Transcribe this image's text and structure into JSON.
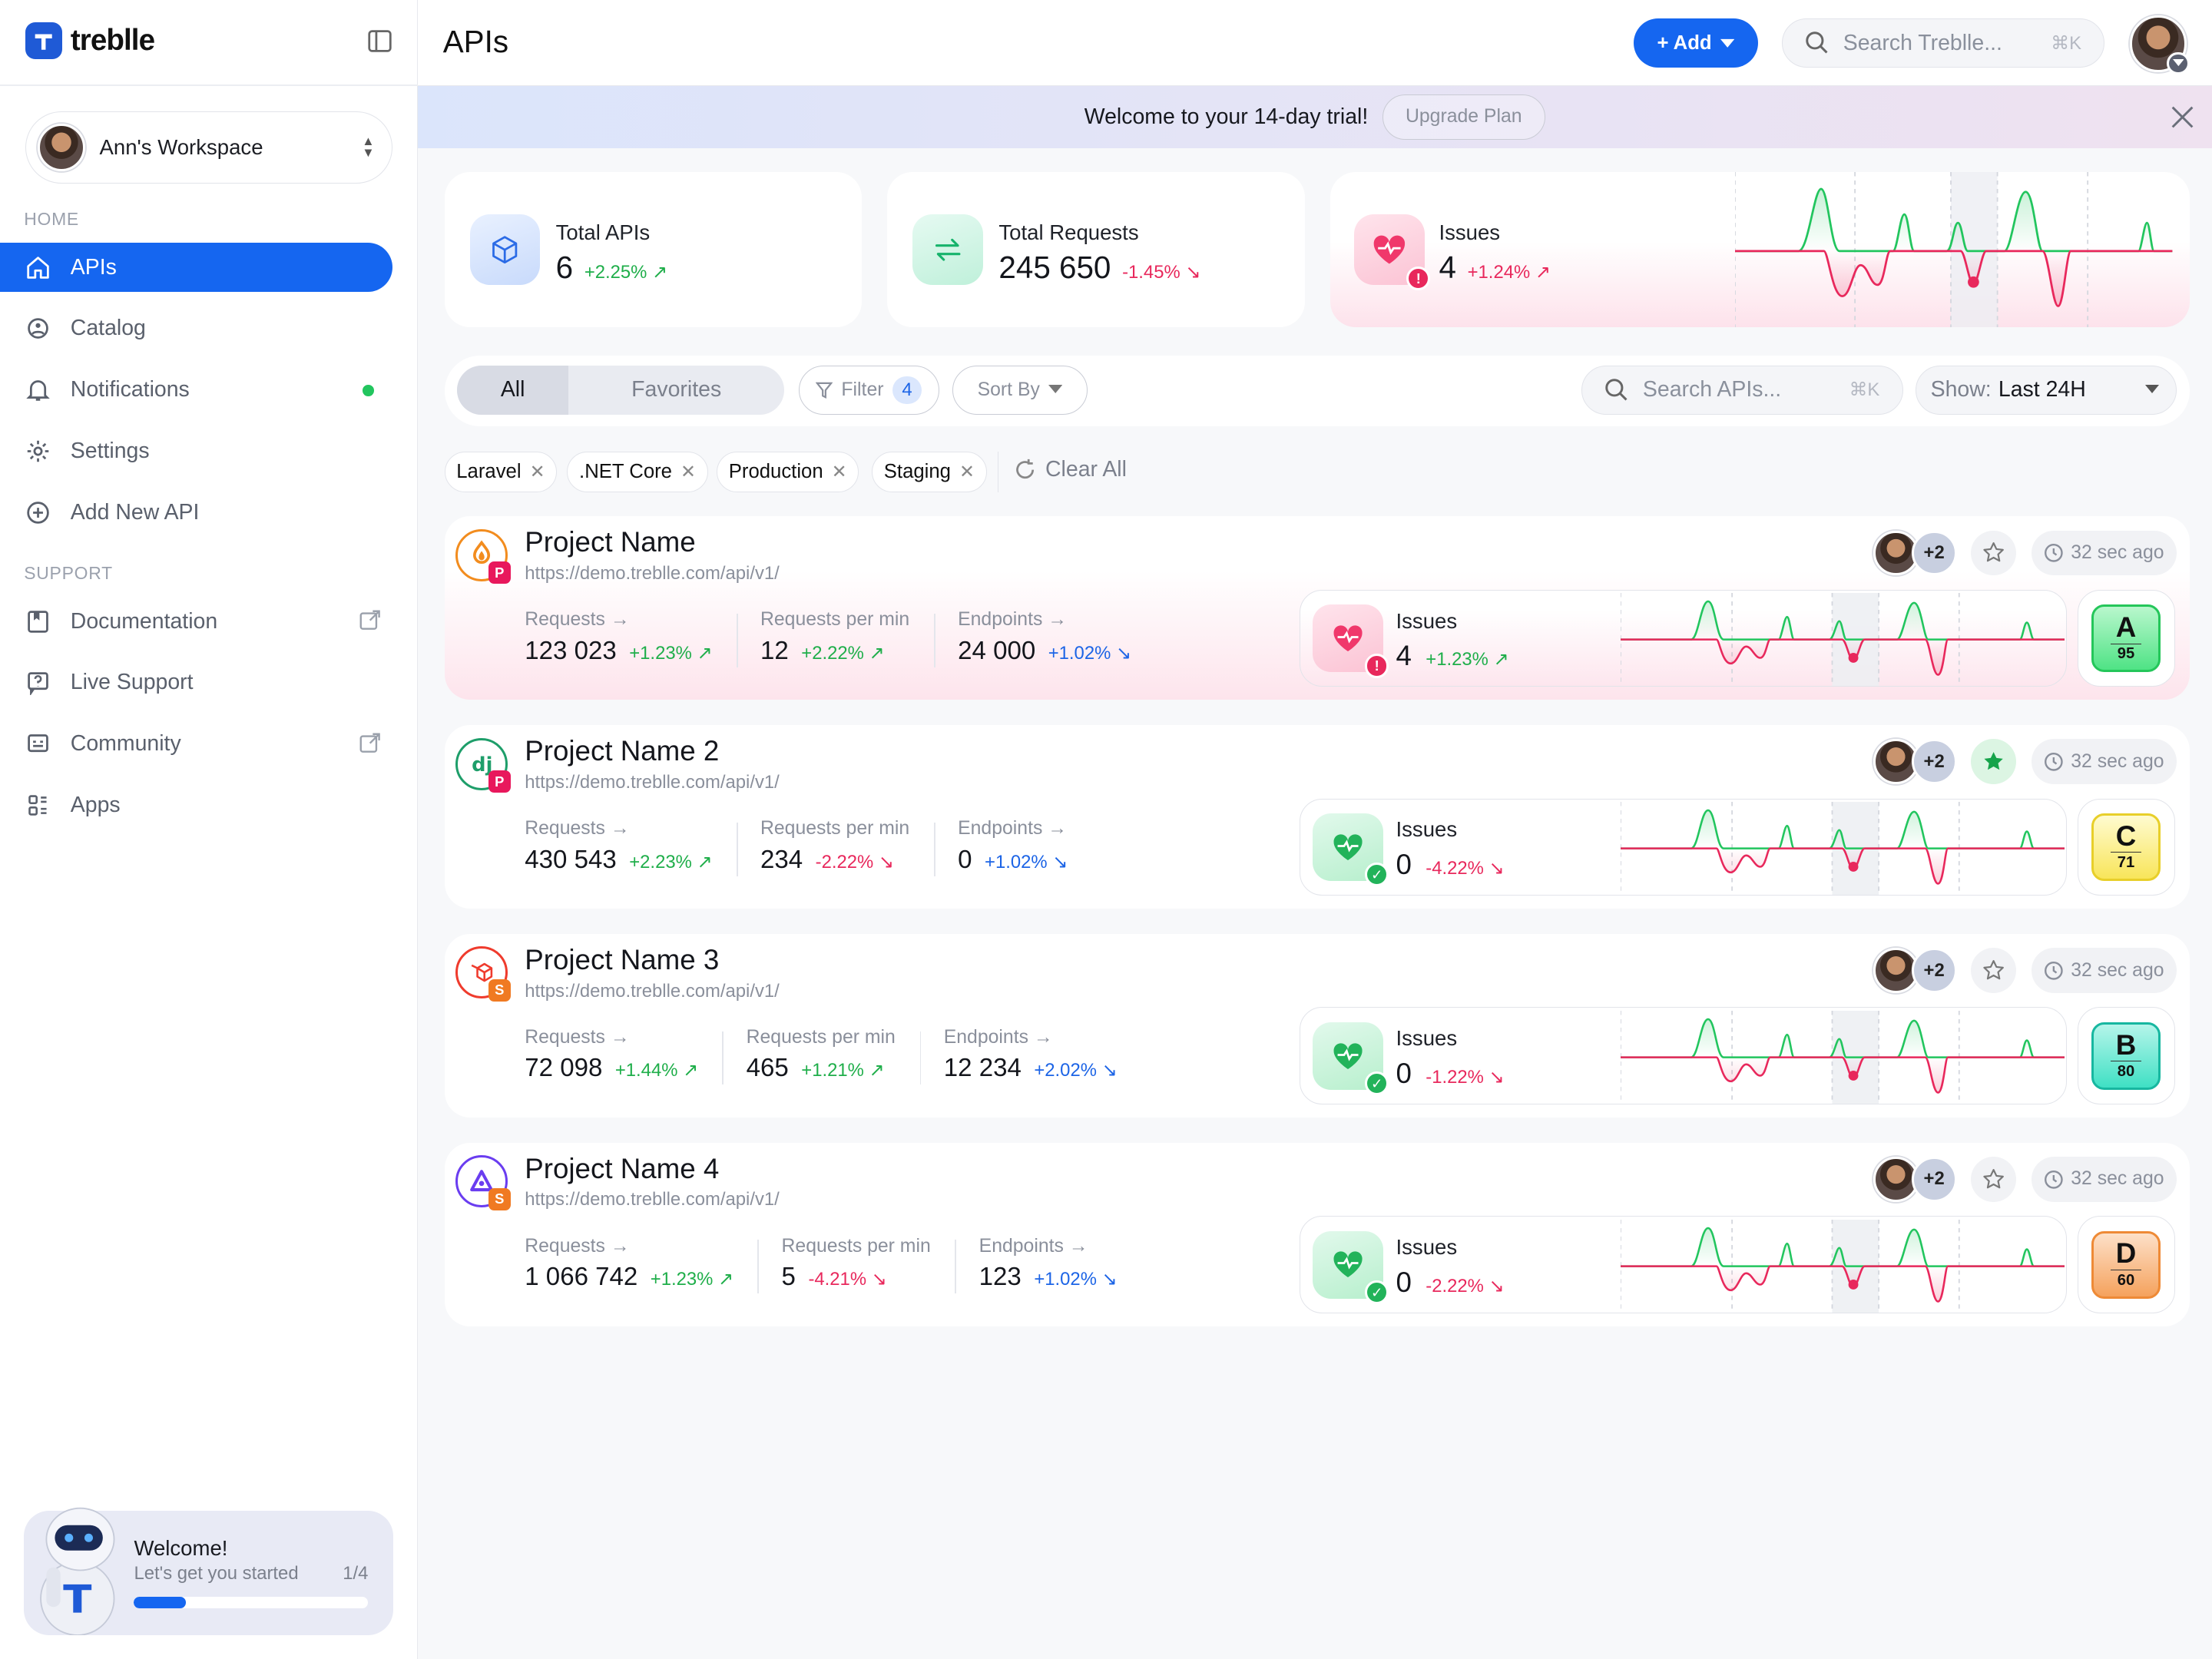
{
  "brand": {
    "name": "treblle"
  },
  "sidebar": {
    "workspace": "Ann's Workspace",
    "home_title": "HOME",
    "support_title": "SUPPORT",
    "home_items": [
      {
        "label": "APIs",
        "icon": "home-icon",
        "active": true
      },
      {
        "label": "Catalog",
        "icon": "catalog-icon"
      },
      {
        "label": "Notifications",
        "icon": "bell-icon",
        "dot": true
      },
      {
        "label": "Settings",
        "icon": "gear-icon"
      },
      {
        "label": "Add New API",
        "icon": "plus-circle-icon"
      }
    ],
    "support_items": [
      {
        "label": "Documentation",
        "icon": "book-icon",
        "external": true
      },
      {
        "label": "Live Support",
        "icon": "help-icon"
      },
      {
        "label": "Community",
        "icon": "community-icon",
        "external": true
      },
      {
        "label": "Apps",
        "icon": "apps-icon"
      }
    ],
    "welcome": {
      "title": "Welcome!",
      "subtitle": "Let's get you started",
      "step": "1/4",
      "progress": 0.22
    }
  },
  "header": {
    "title": "APIs",
    "add_label": "+ Add",
    "search_placeholder": "Search Treblle...",
    "search_shortcut": "⌘K"
  },
  "trial": {
    "text": "Welcome to your 14-day trial!",
    "button": "Upgrade Plan"
  },
  "stats": {
    "total_apis": {
      "label": "Total APIs",
      "value": "6",
      "delta": "+2.25%"
    },
    "total_requests": {
      "label": "Total Requests",
      "value": "245 650",
      "delta": "-1.45%"
    },
    "issues": {
      "label": "Issues",
      "value": "4",
      "delta": "+1.24%"
    }
  },
  "filters": {
    "seg_all": "All",
    "seg_fav": "Favorites",
    "filter_label": "Filter",
    "filter_count": "4",
    "sort_label": "Sort By",
    "search_placeholder": "Search APIs...",
    "search_shortcut": "⌘K",
    "show_label": "Show:",
    "show_value": "Last 24H",
    "tags": [
      "Laravel",
      ".NET Core",
      "Production",
      "Staging"
    ],
    "clear_all": "Clear All"
  },
  "metric_labels": {
    "requests": "Requests →",
    "rpm": "Requests per min",
    "endpoints": "Endpoints →",
    "issues": "Issues"
  },
  "projects": [
    {
      "name": "Project Name",
      "url": "https://demo.treblle.com/api/v1/",
      "env": "P",
      "requests": "123 023",
      "requests_delta": "+1.23%",
      "rpm": "12",
      "rpm_delta": "+2.22%",
      "endpoints": "24 000",
      "endpoints_delta": "+1.02%",
      "issues": "4",
      "issues_delta": "+1.23%",
      "grade": "A",
      "score": "95",
      "time": "32 sec ago",
      "favorite": false,
      "plus": "+2"
    },
    {
      "name": "Project Name 2",
      "url": "https://demo.treblle.com/api/v1/",
      "env": "P",
      "requests": "430 543",
      "requests_delta": "+2.23%",
      "rpm": "234",
      "rpm_delta": "-2.22%",
      "endpoints": "0",
      "endpoints_delta": "+1.02%",
      "issues": "0",
      "issues_delta": "-4.22%",
      "grade": "C",
      "score": "71",
      "time": "32 sec ago",
      "favorite": true,
      "plus": "+2"
    },
    {
      "name": "Project Name 3",
      "url": "https://demo.treblle.com/api/v1/",
      "env": "S",
      "requests": "72 098",
      "requests_delta": "+1.44%",
      "rpm": "465",
      "rpm_delta": "+1.21%",
      "endpoints": "12 234",
      "endpoints_delta": "+2.02%",
      "issues": "0",
      "issues_delta": "-1.22%",
      "grade": "B",
      "score": "80",
      "time": "32 sec ago",
      "favorite": false,
      "plus": "+2"
    },
    {
      "name": "Project Name 4",
      "url": "https://demo.treblle.com/api/v1/",
      "env": "S",
      "requests": "1 066 742",
      "requests_delta": "+1.23%",
      "rpm": "5",
      "rpm_delta": "-4.21%",
      "endpoints": "123",
      "endpoints_delta": "+1.02%",
      "issues": "0",
      "issues_delta": "-2.22%",
      "grade": "D",
      "score": "60",
      "time": "32 sec ago",
      "favorite": false,
      "plus": "+2"
    }
  ],
  "colors": {
    "accent": "#1566f0",
    "positive": "#1fae4a",
    "negative": "#e8285c",
    "info": "#1c64e6",
    "grade_A": "#5ee68a",
    "grade_B": "#4fe3c4",
    "grade_C": "#fbe96a",
    "grade_D": "#f59a52"
  }
}
